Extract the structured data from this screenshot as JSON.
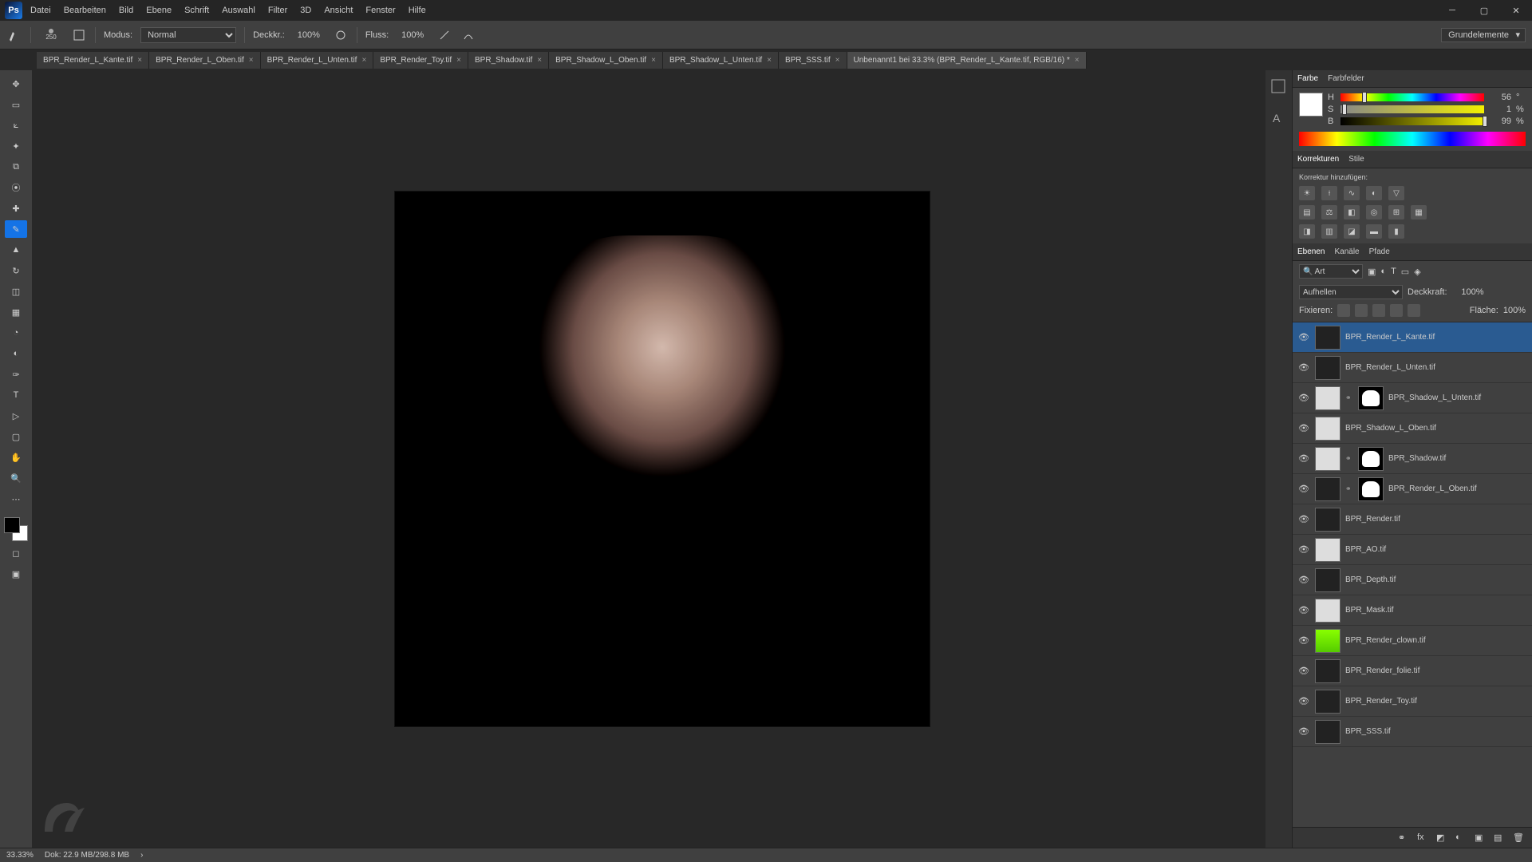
{
  "app": {
    "logo": "Ps"
  },
  "menu": [
    "Datei",
    "Bearbeiten",
    "Bild",
    "Ebene",
    "Schrift",
    "Auswahl",
    "Filter",
    "3D",
    "Ansicht",
    "Fenster",
    "Hilfe"
  ],
  "options": {
    "brush_size": "250",
    "mode_label": "Modus:",
    "mode_value": "Normal",
    "opacity_label": "Deckkr.:",
    "opacity_value": "100%",
    "flow_label": "Fluss:",
    "flow_value": "100%",
    "right_dropdown": "Grundelemente"
  },
  "tabs": [
    {
      "label": "BPR_Render_L_Kante.tif",
      "active": false
    },
    {
      "label": "BPR_Render_L_Oben.tif",
      "active": false
    },
    {
      "label": "BPR_Render_L_Unten.tif",
      "active": false
    },
    {
      "label": "BPR_Render_Toy.tif",
      "active": false
    },
    {
      "label": "BPR_Shadow.tif",
      "active": false
    },
    {
      "label": "BPR_Shadow_L_Oben.tif",
      "active": false
    },
    {
      "label": "BPR_Shadow_L_Unten.tif",
      "active": false
    },
    {
      "label": "BPR_SSS.tif",
      "active": false
    },
    {
      "label": "Unbenannt1 bei 33.3% (BPR_Render_L_Kante.tif, RGB/16) *",
      "active": true
    }
  ],
  "color": {
    "tabs": [
      "Farbe",
      "Farbfelder"
    ],
    "h": {
      "lab": "H",
      "val": "56",
      "unit": "°",
      "pos": 15
    },
    "s": {
      "lab": "S",
      "val": "1",
      "unit": "%",
      "pos": 1
    },
    "b": {
      "lab": "B",
      "val": "99",
      "unit": "%",
      "pos": 99
    }
  },
  "adjust": {
    "tabs": [
      "Korrekturen",
      "Stile"
    ],
    "hint": "Korrektur hinzufügen:"
  },
  "layers_panel": {
    "tabs": [
      "Ebenen",
      "Kanäle",
      "Pfade"
    ],
    "filter": "Art",
    "blend_label": "",
    "blend_value": "Aufhellen",
    "opacity_label": "Deckkraft:",
    "opacity_value": "100%",
    "fix_label": "Fixieren:",
    "fill_label": "Fläche:",
    "fill_value": "100%"
  },
  "layers": [
    {
      "name": "BPR_Render_L_Kante.tif",
      "vis": true,
      "sel": true,
      "mask": false,
      "thumb": "dark"
    },
    {
      "name": "BPR_Render_L_Unten.tif",
      "vis": true,
      "sel": false,
      "mask": false,
      "thumb": "dark"
    },
    {
      "name": "BPR_Shadow_L_Unten.tif",
      "vis": true,
      "sel": false,
      "mask": true,
      "thumb": "light"
    },
    {
      "name": "BPR_Shadow_L_Oben.tif",
      "vis": true,
      "sel": false,
      "mask": false,
      "thumb": "light"
    },
    {
      "name": "BPR_Shadow.tif",
      "vis": true,
      "sel": false,
      "mask": true,
      "thumb": "light"
    },
    {
      "name": "BPR_Render_L_Oben.tif",
      "vis": true,
      "sel": false,
      "mask": true,
      "thumb": "dark"
    },
    {
      "name": "BPR_Render.tif",
      "vis": true,
      "sel": false,
      "mask": false,
      "thumb": "dark"
    },
    {
      "name": "BPR_AO.tif",
      "vis": true,
      "sel": false,
      "mask": false,
      "thumb": "light"
    },
    {
      "name": "BPR_Depth.tif",
      "vis": true,
      "sel": false,
      "mask": false,
      "thumb": "dark"
    },
    {
      "name": "BPR_Mask.tif",
      "vis": true,
      "sel": false,
      "mask": false,
      "thumb": "light"
    },
    {
      "name": "BPR_Render_clown.tif",
      "vis": true,
      "sel": false,
      "mask": false,
      "thumb": "green"
    },
    {
      "name": "BPR_Render_folie.tif",
      "vis": true,
      "sel": false,
      "mask": false,
      "thumb": "dark"
    },
    {
      "name": "BPR_Render_Toy.tif",
      "vis": true,
      "sel": false,
      "mask": false,
      "thumb": "dark"
    },
    {
      "name": "BPR_SSS.tif",
      "vis": true,
      "sel": false,
      "mask": false,
      "thumb": "dark"
    }
  ],
  "status": {
    "zoom": "33.33%",
    "doc": "Dok: 22.9 MB/298.8 MB"
  }
}
